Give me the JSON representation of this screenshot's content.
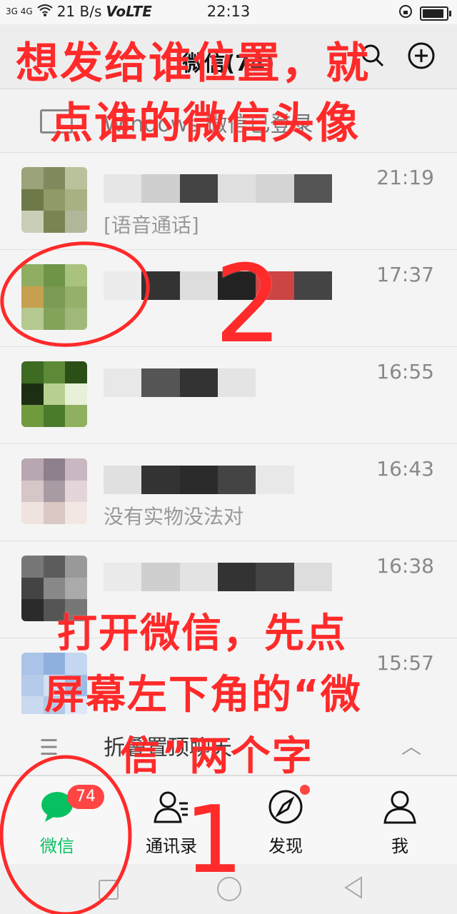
{
  "status_bar": {
    "signal": "3G 4G",
    "net_speed": "21 B/s",
    "volte": "VoLTE",
    "time": "22:13"
  },
  "header": {
    "title": "微信(74)"
  },
  "pc_login": {
    "text": "Windows 微信已登录"
  },
  "chats": [
    {
      "time": "21:19",
      "preview": "[语音通话]"
    },
    {
      "time": "17:37",
      "preview": ""
    },
    {
      "time": "16:55",
      "preview": ""
    },
    {
      "time": "16:43",
      "preview": "没有实物没法对"
    },
    {
      "time": "16:38",
      "preview": ""
    },
    {
      "time": "15:57",
      "preview": ""
    }
  ],
  "folded": {
    "label": "折叠置顶聊天"
  },
  "tabs": [
    {
      "label": "微信",
      "badge": "74"
    },
    {
      "label": "通讯录"
    },
    {
      "label": "发现"
    },
    {
      "label": "我"
    }
  ],
  "annotations": {
    "top_line1": "想发给谁位置，就",
    "top_line2": "点谁的微信头像",
    "step2": "2",
    "mid_line1": "打开微信，先点",
    "mid_line2": "屏幕左下角的“微",
    "mid_line3": "信”两个字",
    "step1": "1"
  },
  "colors": {
    "accent": "#07c160",
    "badge": "#ff4444",
    "annotation": "#ff2a2a"
  }
}
